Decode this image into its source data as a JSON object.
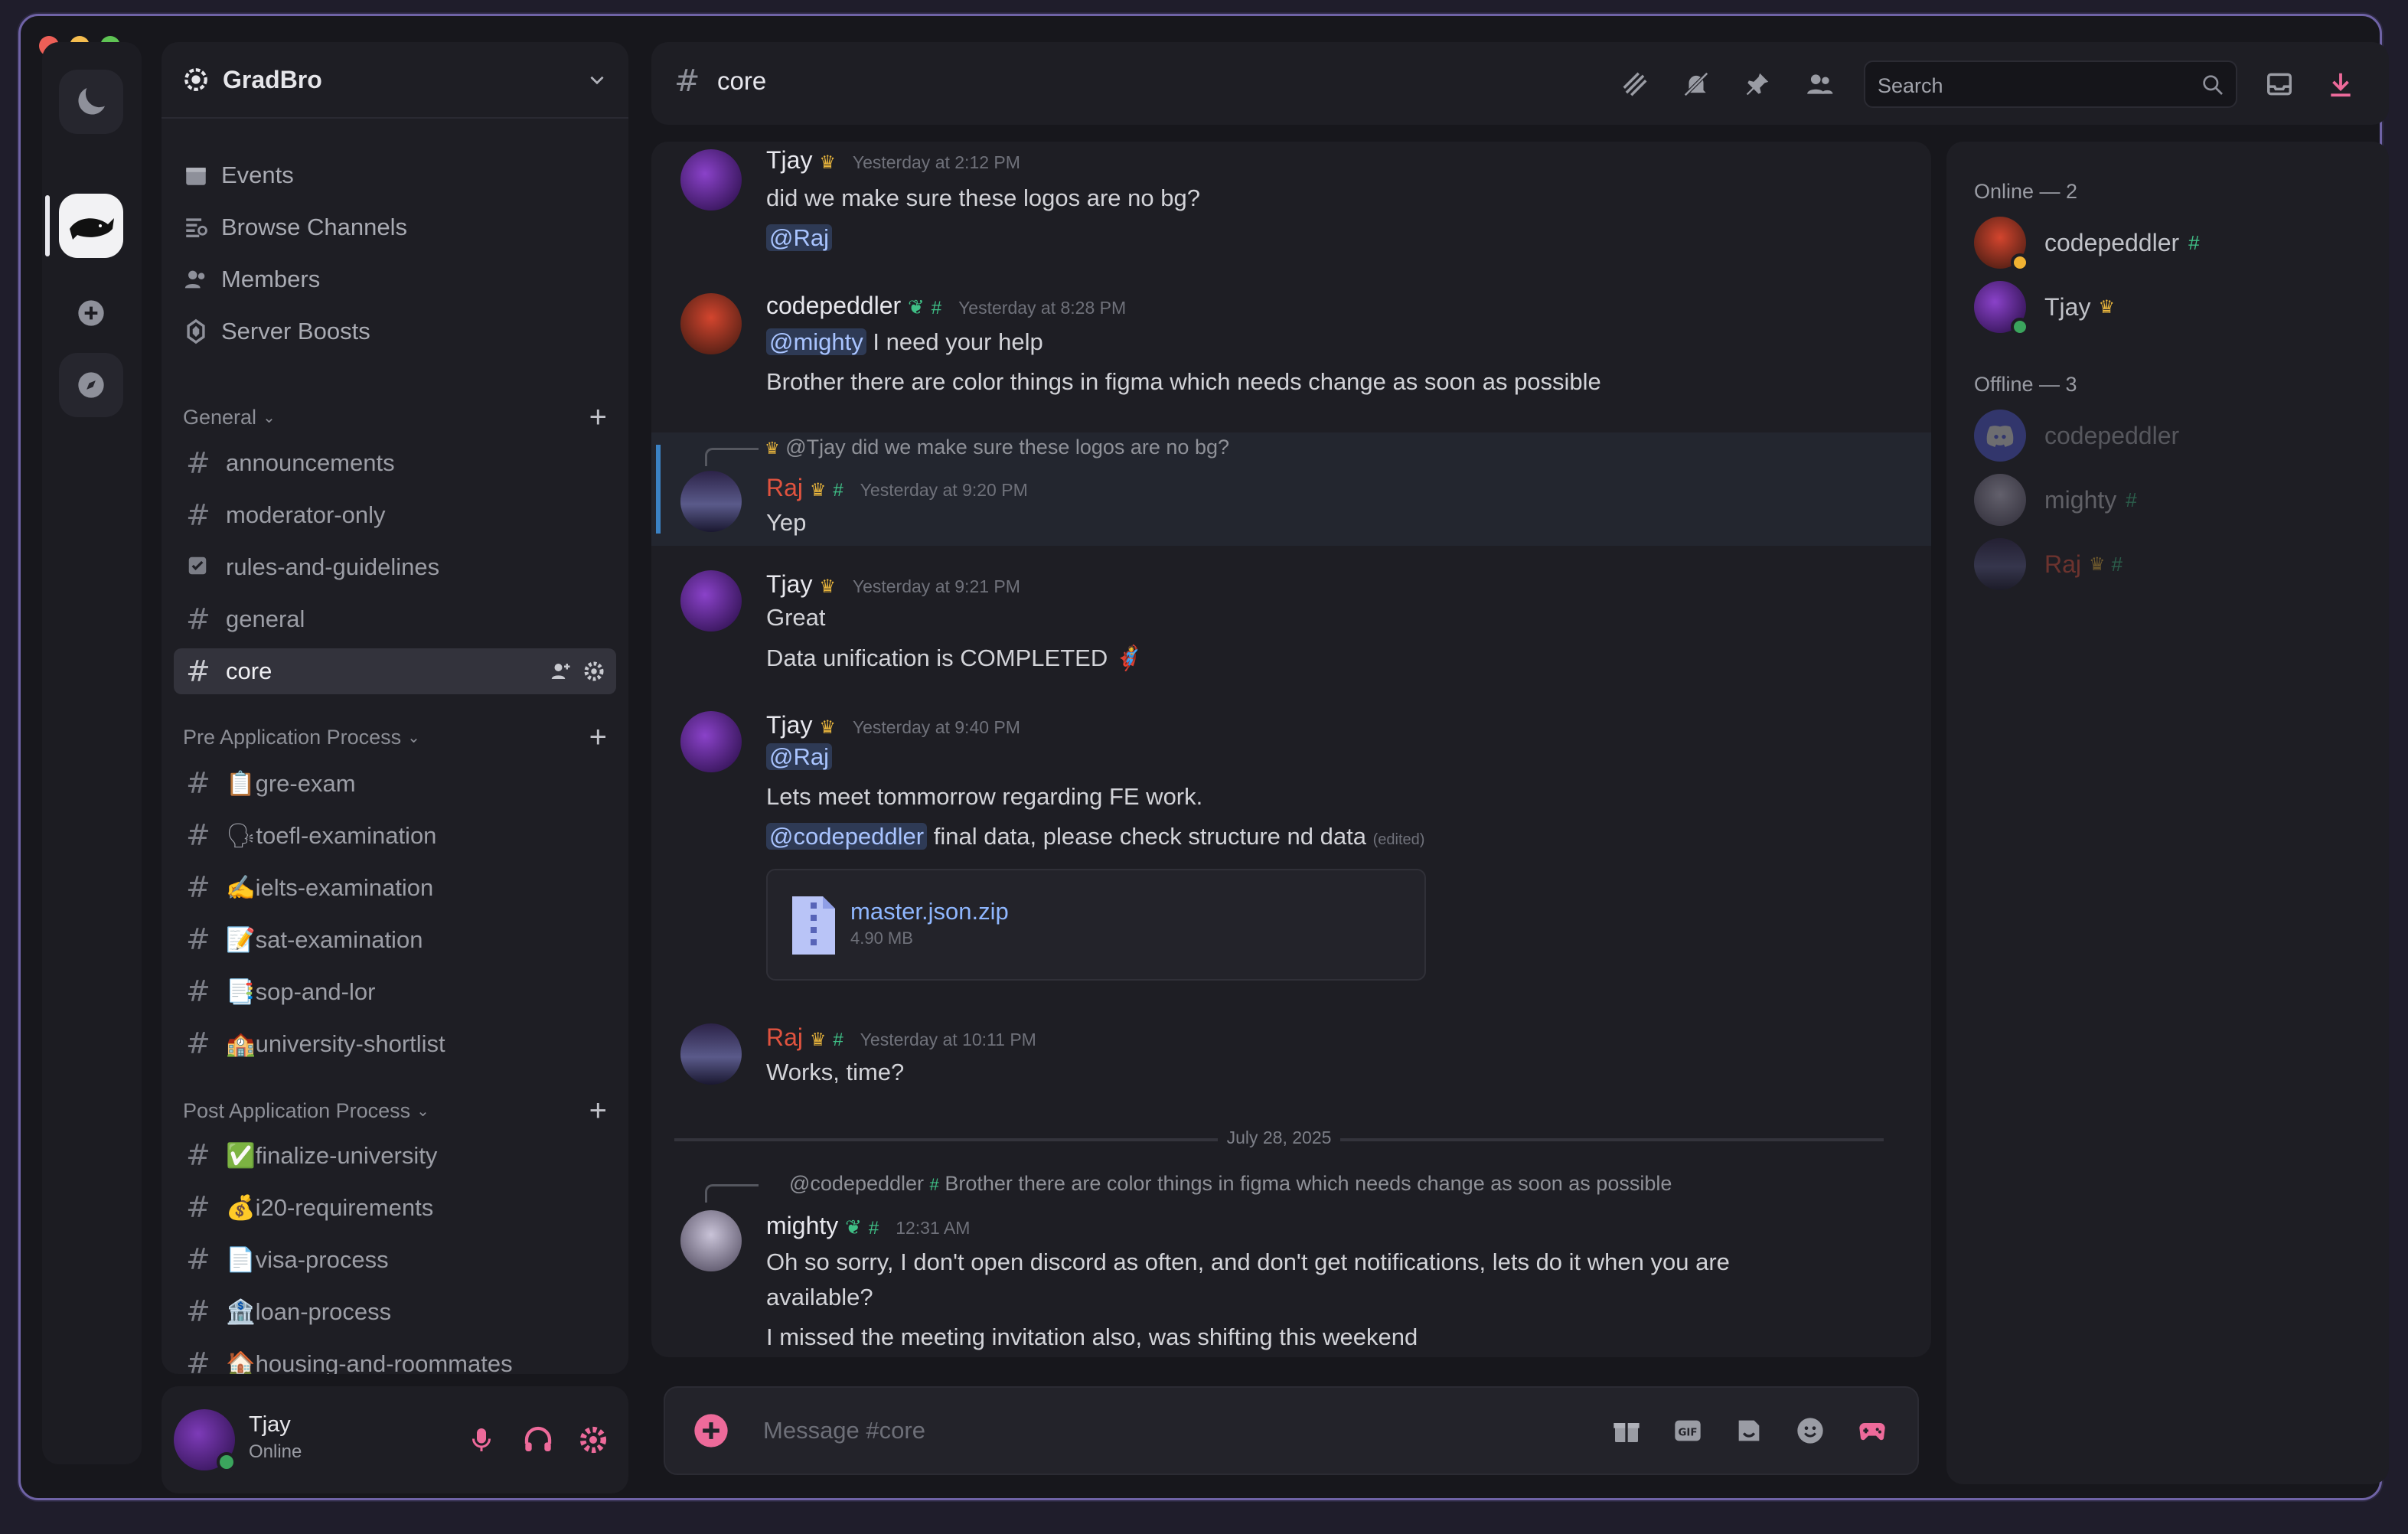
{
  "window": {
    "title": "GradBro"
  },
  "server": {
    "name": "GradBro"
  },
  "nav": [
    {
      "label": "Events",
      "icon": "calendar-icon"
    },
    {
      "label": "Browse Channels",
      "icon": "browse-icon"
    },
    {
      "label": "Members",
      "icon": "members-icon"
    },
    {
      "label": "Server Boosts",
      "icon": "boost-icon"
    }
  ],
  "categories": {
    "general": "General",
    "pre": "Pre Application Process",
    "post": "Post Application Process"
  },
  "channels": {
    "general": [
      "announcements",
      "moderator-only",
      "rules-and-guidelines",
      "general",
      "core"
    ],
    "pre": [
      "📋gre-exam",
      "🗣toefl-examination",
      "✍ielts-examination",
      "📝sat-examination",
      "📑sop-and-lor",
      "🏫university-shortlist"
    ],
    "post": [
      "✅finalize-university",
      "💰i20-requirements",
      "📄visa-process",
      "🏦loan-process",
      "🏠housing-and-roommates"
    ]
  },
  "user": {
    "name": "Tjay",
    "status": "Online"
  },
  "header": {
    "channel": "core",
    "search_placeholder": "Search"
  },
  "messages": [
    {
      "author": "Tjay",
      "time": "Yesterday at 2:12 PM",
      "lines": [
        "did we make sure these logos are no bg?"
      ],
      "mention": "@Raj"
    },
    {
      "author": "codepeddler",
      "time": "Yesterday at 8:28 PM",
      "mention": "@mighty",
      "line1_rest": " I need your help",
      "line2": "Brother there are color things in figma which needs change as soon as possible"
    },
    {
      "author": "Raj",
      "time": "Yesterday at 9:20 PM",
      "reply_author": "@Tjay",
      "reply_text": "did we make sure these logos are no bg?",
      "line": "Yep"
    },
    {
      "author": "Tjay",
      "time": "Yesterday at 9:21 PM",
      "line1": "Great",
      "line2": "Data unification is COMPLETED 🦸"
    },
    {
      "author": "Tjay",
      "time": "Yesterday at 9:40 PM",
      "mention1": "@Raj",
      "line2": "Lets meet tommorrow regarding FE work.",
      "mention2": "@codepeddler",
      "line3_rest": " final data, please check structure nd data",
      "edited": "(edited)",
      "file_name": "master.json.zip",
      "file_size": "4.90 MB"
    },
    {
      "author": "Raj",
      "time": "Yesterday at 10:11 PM",
      "line": "Works, time?"
    },
    {
      "author": "mighty",
      "time": "12:31 AM",
      "reply_author": "@codepeddler",
      "reply_text": "Brother there are color things in figma which needs change as soon as possible",
      "line1": "Oh so sorry, I don't open discord as often, and don't get notifications, lets do it when you are",
      "line1b": "available?",
      "line2": "I missed the meeting invitation also, was shifting this weekend"
    }
  ],
  "divider": "July 28, 2025",
  "composer": {
    "placeholder": "Message #core"
  },
  "members": {
    "online_label": "Online — 2",
    "online": [
      "codepeddler",
      "Tjay"
    ],
    "offline_label": "Offline — 3",
    "offline": [
      "codepeddler",
      "mighty",
      "Raj"
    ]
  },
  "colors": {
    "accent": "#6f63a6",
    "raj": "#e0533f",
    "mention_bg": "#2e3a55",
    "online": "#3ba55d"
  }
}
